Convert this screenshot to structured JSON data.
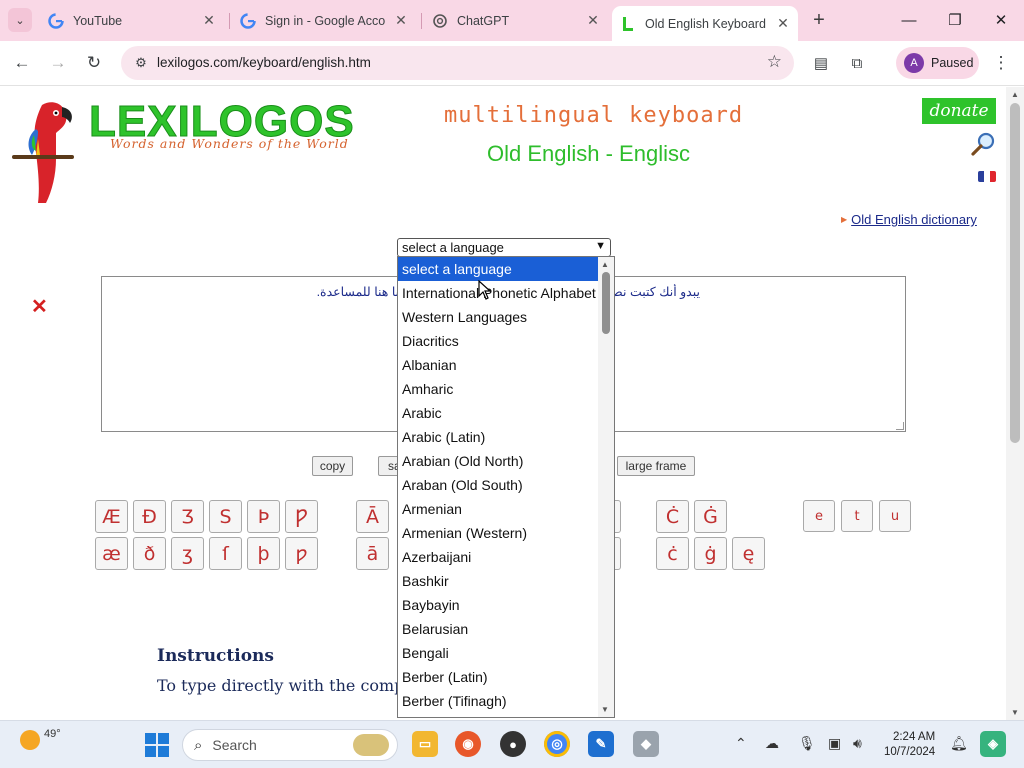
{
  "browser": {
    "tabs": [
      {
        "label": "YouTube",
        "icon": "google-icon",
        "active": false
      },
      {
        "label": "Sign in - Google Acco",
        "icon": "google-icon",
        "active": false
      },
      {
        "label": "ChatGPT",
        "icon": "chatgpt-icon",
        "active": false
      },
      {
        "label": "Old English Keyboard",
        "icon": "lexilogos-icon",
        "active": true
      }
    ],
    "url": "lexilogos.com/keyboard/english.htm",
    "profile_initial": "A",
    "profile_label": "Paused"
  },
  "page": {
    "logo_text": "LEXILOGOS",
    "logo_subtitle": "Words and Wonders of the World",
    "heading": "multilingual keyboard",
    "subheading": "Old English - Englisc",
    "donate_label": "donate",
    "dictionary_link": "Old English dictionary",
    "select_value": "select a language",
    "textarea_text": "يبدو أنك كتبت نص معين تود مناقشته، فلا تتردد في طرحه! أنا هنا للمساعدة.",
    "buttons": {
      "copy": "copy",
      "save": "sa",
      "large_frame": "large frame"
    },
    "keys_upper_left": [
      "Æ",
      "Đ",
      "Ʒ",
      "S",
      "Þ",
      "Ƿ"
    ],
    "keys_lower_left": [
      "æ",
      "ð",
      "ʒ",
      "ſ",
      "þ",
      "ƿ"
    ],
    "keys_upper_mid": [
      "Ā"
    ],
    "keys_lower_mid": [
      "ā"
    ],
    "keys_upper_right": [
      "Ċ",
      "Ġ"
    ],
    "keys_lower_right": [
      "ċ",
      "ġ",
      "ę"
    ],
    "keys_small": [
      "e",
      "t",
      "u"
    ],
    "instructions_title": "Instructions",
    "instructions_text": "To type directly with the comp"
  },
  "dropdown": {
    "options": [
      "select a language",
      "International Phonetic Alphabet",
      "Western Languages",
      "Diacritics",
      "Albanian",
      "Amharic",
      "Arabic",
      "Arabic (Latin)",
      "Arabian (Old North)",
      "Araban (Old South)",
      "Armenian",
      "Armenian (Western)",
      "Azerbaijani",
      "Bashkir",
      "Baybayin",
      "Belarusian",
      "Bengali",
      "Berber (Latin)",
      "Berber (Tifinagh)"
    ],
    "selected_index": 0
  },
  "taskbar": {
    "weather_temp": "49°",
    "search_placeholder": "Search",
    "time": "2:24 AM",
    "date": "10/7/2024"
  },
  "colors": {
    "accent_green": "#2ec32b",
    "accent_orange": "#e46f3a",
    "selection_blue": "#1a5fd6",
    "tab_bar_pink": "#f9d8e6"
  }
}
